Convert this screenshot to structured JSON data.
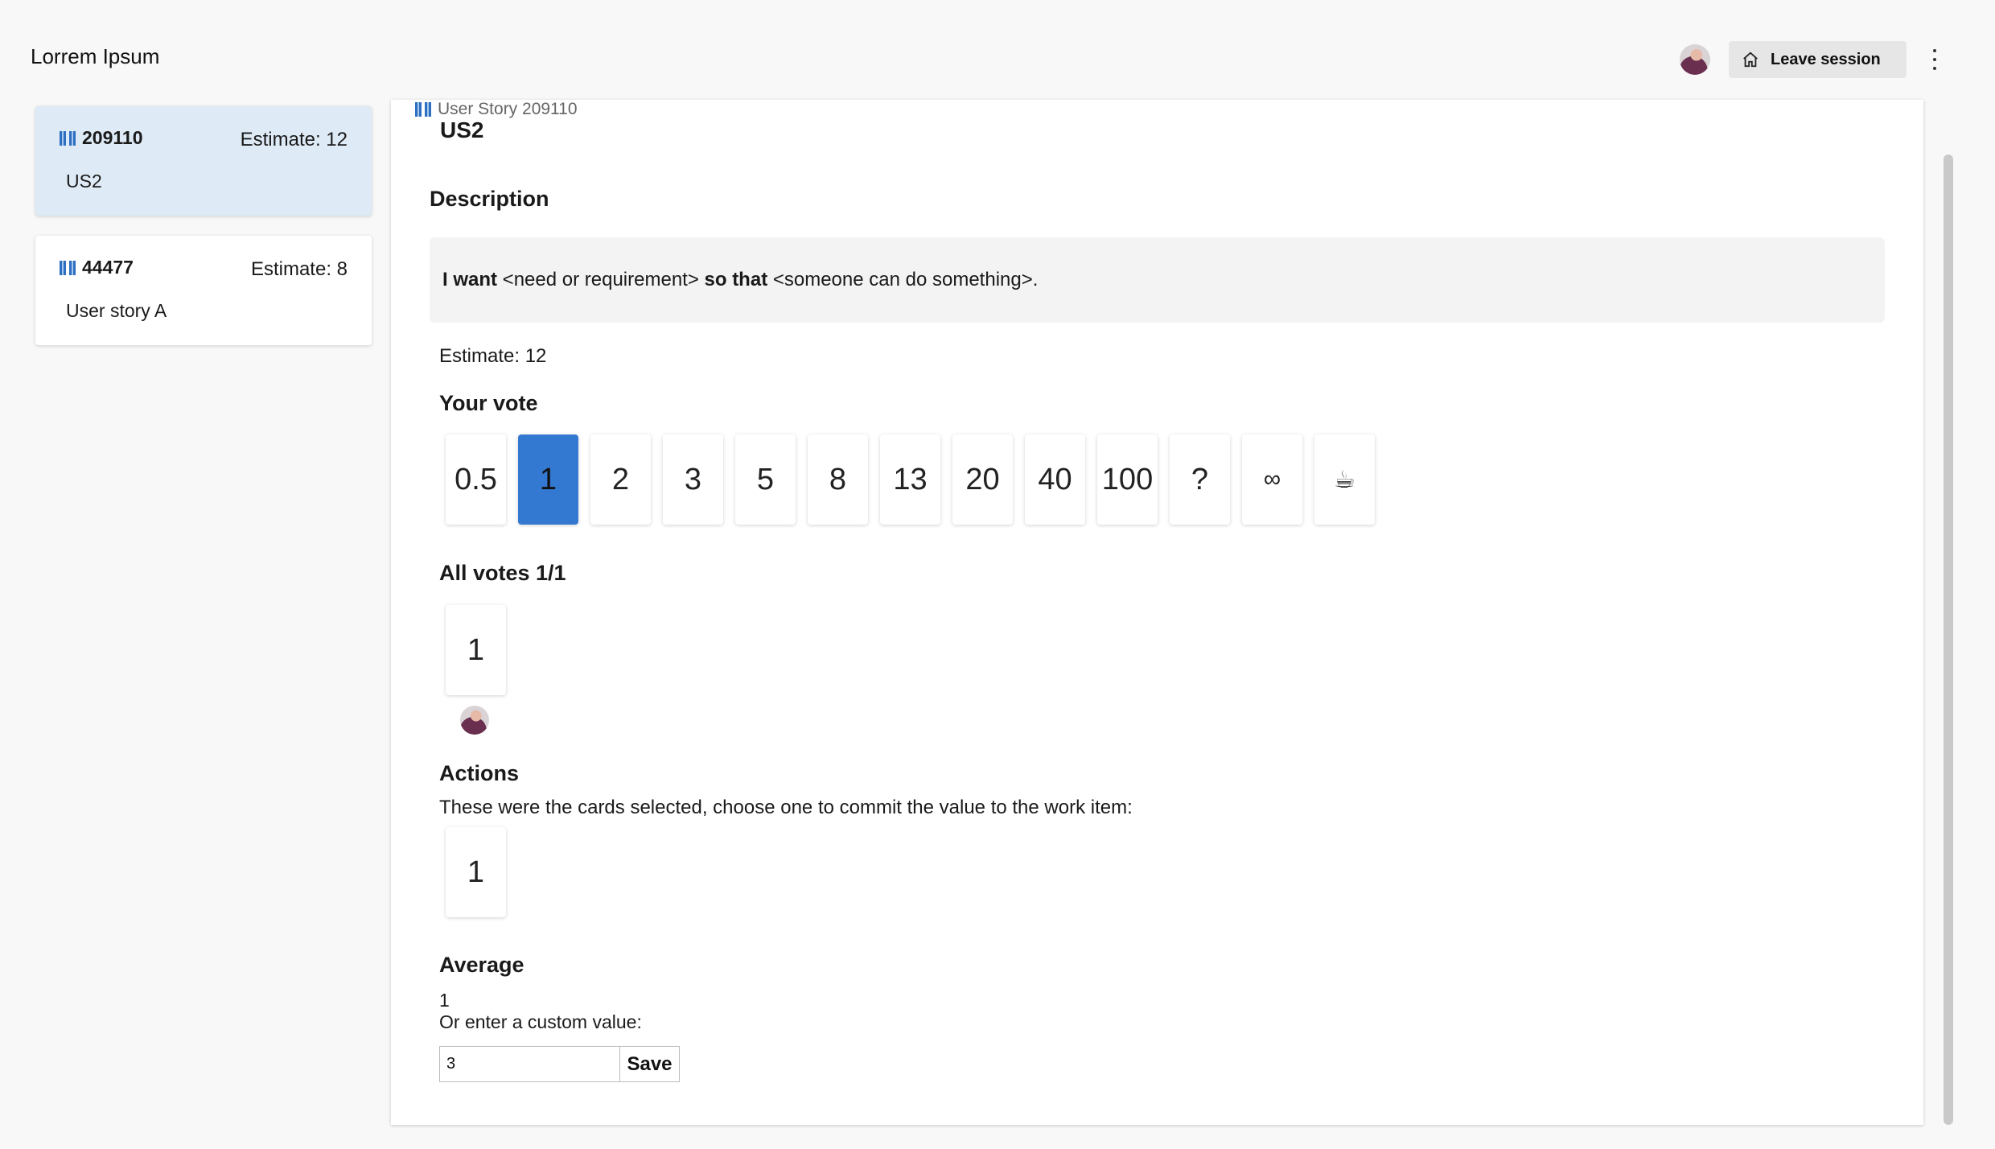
{
  "app": {
    "title": "Lorrem Ipsum"
  },
  "header": {
    "leave_label": "Leave session"
  },
  "sidebar": {
    "stories": [
      {
        "id": "209110",
        "estimate": "Estimate: 12",
        "title": "US2",
        "selected": true
      },
      {
        "id": "44477",
        "estimate": "Estimate: 8",
        "title": "User story A",
        "selected": false
      }
    ]
  },
  "story": {
    "breadcrumb": "User Story 209110",
    "name": "US2",
    "description_heading": "Description",
    "description": {
      "p1_bold": "I want",
      "p1": " <need or requirement> ",
      "p2_bold": "so that",
      "p2": " <someone can do something>."
    },
    "estimate": "Estimate: 12"
  },
  "vote": {
    "heading": "Your vote",
    "cards": [
      "0.5",
      "1",
      "2",
      "3",
      "5",
      "8",
      "13",
      "20",
      "40",
      "100",
      "?",
      "∞",
      "☕"
    ],
    "selected": "1"
  },
  "all_votes": {
    "heading": "All votes 1/1",
    "cards": [
      "1"
    ]
  },
  "actions": {
    "heading": "Actions",
    "text": "These were the cards selected, choose one to commit the value to the work item:",
    "cards": [
      "1"
    ]
  },
  "average": {
    "heading": "Average",
    "value": "1",
    "custom_label": "Or enter a custom value:",
    "custom_value": "3",
    "save_label": "Save"
  },
  "colors": {
    "accent": "#3479d1",
    "selected_story_bg": "#deeaf6"
  }
}
